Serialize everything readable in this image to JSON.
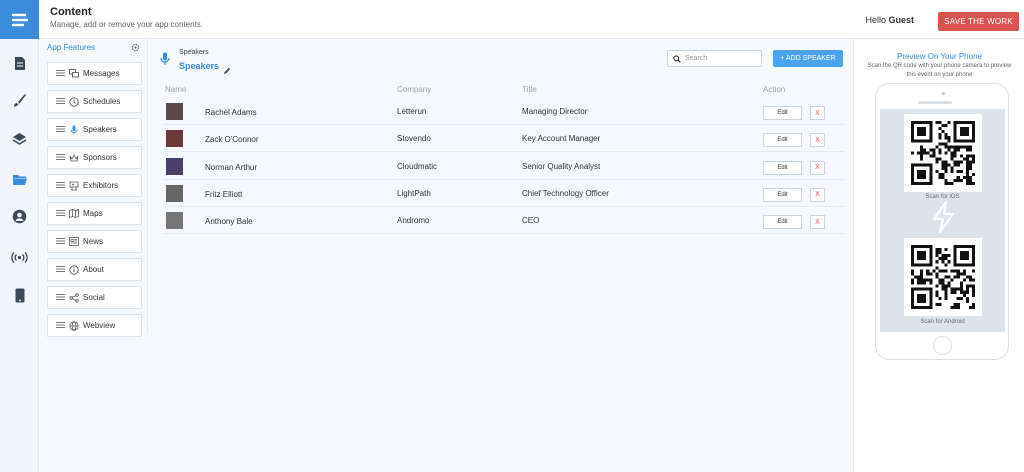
{
  "header": {
    "title": "Content",
    "subtitle": "Manage, add or remove your app contents.",
    "hello_prefix": "Hello",
    "hello_user": "Guest",
    "save_label": "SAVE THE WORK"
  },
  "rail": {
    "icons": [
      "logo-icon",
      "document-icon",
      "brush-icon",
      "layers-icon",
      "folder-icon",
      "user-icon",
      "broadcast-icon",
      "phone-icon"
    ],
    "active": "folder-icon"
  },
  "features": {
    "heading": "App Features",
    "items": [
      {
        "label": "Messages",
        "icon": "messages-icon"
      },
      {
        "label": "Schedules",
        "icon": "clock-icon"
      },
      {
        "label": "Speakers",
        "icon": "microphone-icon"
      },
      {
        "label": "Sponsors",
        "icon": "crown-icon"
      },
      {
        "label": "Exhibitors",
        "icon": "exhibitor-icon"
      },
      {
        "label": "Maps",
        "icon": "map-icon"
      },
      {
        "label": "News",
        "icon": "newspaper-icon"
      },
      {
        "label": "About",
        "icon": "info-icon"
      },
      {
        "label": "Social",
        "icon": "share-icon"
      },
      {
        "label": "Webview",
        "icon": "globe-icon"
      }
    ]
  },
  "speakers": {
    "breadcrumb": "Speakers",
    "title": "Speakers",
    "search_placeholder": "Search",
    "add_label": "+ ADD SPEAKER",
    "columns": [
      "Name",
      "Company",
      "Title",
      "Action"
    ],
    "edit_label": "Edit",
    "delete_label": "X",
    "rows": [
      {
        "name": "Rachel Adams",
        "company": "Letterun",
        "title": "Managing Director"
      },
      {
        "name": "Zack O'Connor",
        "company": "Stovendo",
        "title": "Key Account Manager"
      },
      {
        "name": "Norman Arthur",
        "company": "Cloudmatic",
        "title": "Senior Quality Analyst"
      },
      {
        "name": "Fritz Elliott",
        "company": "LightPath",
        "title": "Chief Technology Officer"
      },
      {
        "name": "Anthony Bale",
        "company": "Andromo",
        "title": "CEO"
      }
    ]
  },
  "preview": {
    "title": "Preview On Your Phone",
    "description": "Scan the QR code with your phone camera to preview this event on your phone",
    "ios_label": "Scan for iOS",
    "android_label": "Scan for Android"
  },
  "colors": {
    "accent": "#3a8bd9",
    "save": "#d9534f",
    "add": "#4aa3ee"
  }
}
